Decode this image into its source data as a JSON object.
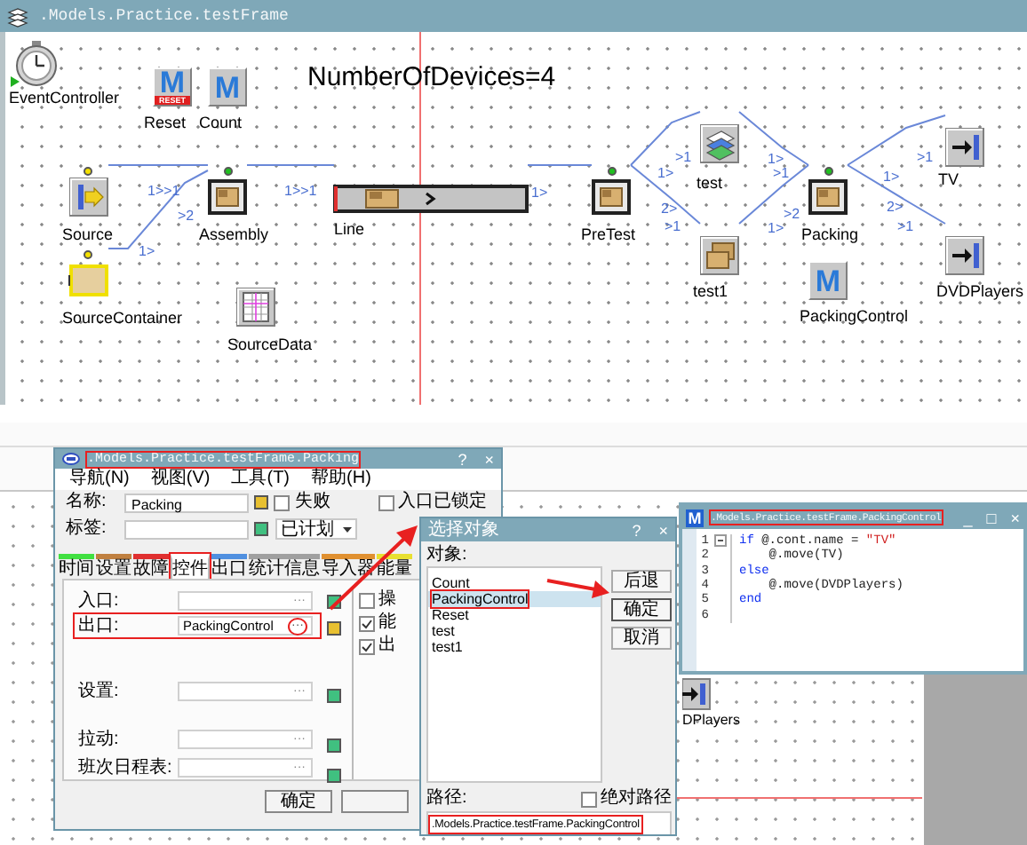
{
  "frame": {
    "title": ".Models.Practice.testFrame",
    "comment": "NumberOfDevices=4",
    "objects": [
      {
        "name": "EventController",
        "kind": "clock"
      },
      {
        "name": "Reset",
        "kind": "method",
        "glyph": "M",
        "badge": "RESET"
      },
      {
        "name": "Count",
        "kind": "method",
        "glyph": "M"
      },
      {
        "name": "Source",
        "kind": "source",
        "color": "#f4e000"
      },
      {
        "name": "SourceContainer",
        "kind": "source_container",
        "color": "#f4e000"
      },
      {
        "name": "Assembly",
        "kind": "station",
        "color": "#20c020"
      },
      {
        "name": "Line",
        "kind": "line"
      },
      {
        "name": "PreTest",
        "kind": "station",
        "color": "#20c020"
      },
      {
        "name": "test",
        "kind": "layers"
      },
      {
        "name": "test1",
        "kind": "buffer"
      },
      {
        "name": "Packing",
        "kind": "station",
        "color": "#20c020"
      },
      {
        "name": "PackingControl",
        "kind": "method",
        "glyph": "M"
      },
      {
        "name": "TV",
        "kind": "drain"
      },
      {
        "name": "DVDPlayers",
        "kind": "drain"
      },
      {
        "name": "SourceData",
        "kind": "table"
      }
    ],
    "connector_labels": [
      "1>>1",
      ">2",
      "1>",
      "1>>1",
      "1>",
      "1>",
      ">1",
      "2>",
      ">1",
      "1>",
      ">1",
      "1>",
      ">2",
      "1>",
      ">1",
      "2>",
      ">1"
    ]
  },
  "background": {
    "object_label": "DPlayers"
  },
  "packing_dialog": {
    "title": ".Models.Practice.testFrame.Packing",
    "title_highlighted": true,
    "help_button": "?",
    "close_button": "×",
    "menu": [
      "导航(N)",
      "视图(V)",
      "工具(T)",
      "帮助(H)"
    ],
    "attributes": [
      {
        "label": "名称:",
        "value": "Packing",
        "color": "#e8c030"
      },
      {
        "label": "标签:",
        "color": "#40c080"
      }
    ],
    "failed": {
      "label": "失败",
      "checked": false
    },
    "status": "已计划",
    "entry_locked": {
      "label": "入口已锁定",
      "checked": false
    },
    "tabs": [
      {
        "label": "时间",
        "color": "#40e040",
        "selected": false,
        "highlighted": false
      },
      {
        "label": "设置",
        "color": "#c08040",
        "selected": false,
        "highlighted": false
      },
      {
        "label": "故障",
        "color": "#e03030",
        "selected": false,
        "highlighted": false
      },
      {
        "label": "控件",
        "selected": true,
        "highlighted": true
      },
      {
        "label": "出口",
        "color": "#5090e0",
        "selected": false,
        "highlighted": false
      },
      {
        "label": "统计信息",
        "color": "#a0a0a0",
        "selected": false,
        "highlighted": false
      },
      {
        "label": "导入器",
        "color": "#e09030",
        "selected": false,
        "highlighted": false
      },
      {
        "label": "能量",
        "color": "#e8e030",
        "selected": false,
        "highlighted": false
      }
    ],
    "fields": [
      {
        "label": "入口:",
        "button": "···",
        "color": "#40c080",
        "highlighted": false
      },
      {
        "label": "出口:",
        "value": "PackingControl",
        "button": "···",
        "color": "#e8c030",
        "highlighted": true
      },
      {
        "label": "设置:",
        "button": "···",
        "color": "#40c080",
        "highlighted": false
      },
      {
        "label": "拉动:",
        "button": "···",
        "color": "#40c080",
        "highlighted": false
      },
      {
        "label": "班次日程表:",
        "button": "···",
        "color": "#40c080",
        "highlighted": false
      }
    ],
    "options": [
      {
        "label": "操",
        "checked": false
      },
      {
        "label": "能",
        "checked": true
      },
      {
        "label": "出",
        "checked": true
      }
    ],
    "ok_button": "确定"
  },
  "select_dialog": {
    "title": "选择对象",
    "help_button": "?",
    "close_button": "×",
    "list_label": "对象:",
    "items": [
      {
        "label": "Count",
        "selected": false,
        "highlighted": false
      },
      {
        "label": "PackingControl",
        "selected": true,
        "highlighted": true
      },
      {
        "label": "Reset",
        "selected": false,
        "highlighted": false
      },
      {
        "label": "test",
        "selected": false,
        "highlighted": false
      },
      {
        "label": "test1",
        "selected": false,
        "highlighted": false
      }
    ],
    "buttons": [
      {
        "label": "后退",
        "default": false
      },
      {
        "label": "确定",
        "default": true
      },
      {
        "label": "取消",
        "default": false
      }
    ],
    "path_label": "路径:",
    "absolute_path": {
      "label": "绝对路径",
      "checked": false
    },
    "path_value": ".Models.Practice.testFrame.PackingControl",
    "path_highlighted": true
  },
  "code_editor": {
    "icon_glyph": "M",
    "title": ".Models.Practice.testFrame.PackingControl",
    "title_highlighted": true,
    "window_buttons": [
      "_",
      "□",
      "×"
    ],
    "lines": [
      {
        "number": "1",
        "tokens": [
          {
            "text": "if",
            "kind": "keyword"
          },
          {
            "text": " @.cont.name = ",
            "kind": "plain"
          },
          {
            "text": "\"TV\"",
            "kind": "string"
          }
        ]
      },
      {
        "number": "2",
        "tokens": [
          {
            "text": "    @.move(TV)",
            "kind": "plain"
          }
        ]
      },
      {
        "number": "3",
        "tokens": [
          {
            "text": "else",
            "kind": "keyword"
          }
        ]
      },
      {
        "number": "4",
        "tokens": [
          {
            "text": "    @.move(DVDPlayers)",
            "kind": "plain"
          }
        ]
      },
      {
        "number": "5",
        "tokens": [
          {
            "text": "end",
            "kind": "keyword"
          }
        ]
      },
      {
        "number": "6"
      }
    ]
  }
}
